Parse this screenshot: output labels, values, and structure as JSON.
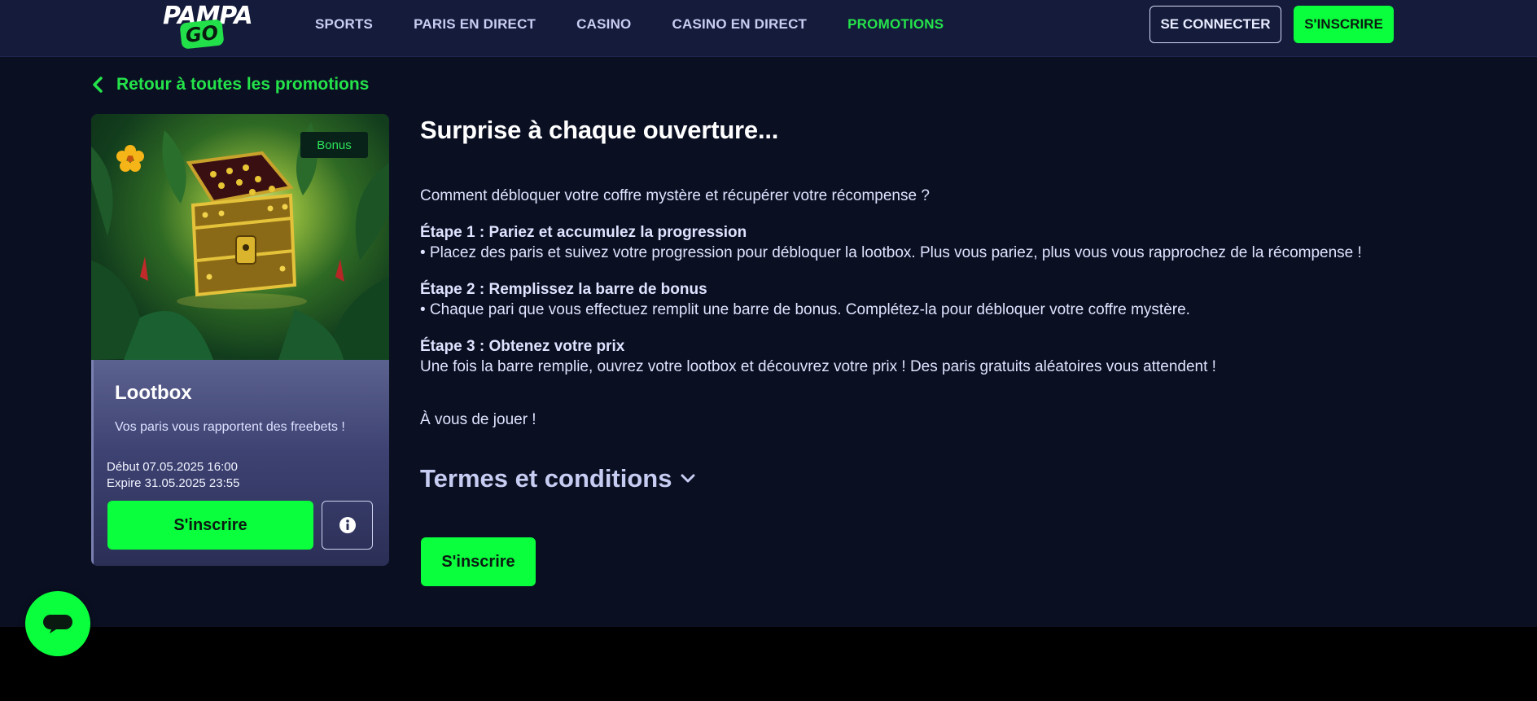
{
  "header": {
    "logo_word": "PAMPA",
    "logo_go": "GO",
    "nav": [
      "SPORTS",
      "PARIS EN DIRECT",
      "CASINO",
      "CASINO EN DIRECT",
      "PROMOTIONS"
    ],
    "active_nav": "PROMOTIONS",
    "login_label": "SE CONNECTER",
    "register_label": "S'INSCRIRE"
  },
  "back_link": "Retour à toutes les promotions",
  "card": {
    "badge": "Bonus",
    "title": "Lootbox",
    "subtitle": "Vos paris vous rapportent des freebets !",
    "start": "Début 07.05.2025 16:00",
    "end": "Expire 31.05.2025 23:55",
    "cta": "S'inscrire",
    "info_icon": "info-icon"
  },
  "content": {
    "title": "Surprise à chaque ouverture...",
    "intro": "Comment débloquer votre coffre mystère et récupérer votre récompense ?",
    "steps": [
      {
        "heading": "Étape 1 : Pariez et accumulez la progression",
        "text": "• Placez des paris et suivez votre progression pour débloquer la lootbox. Plus vous pariez, plus vous vous rapprochez de la récompense !"
      },
      {
        "heading": "Étape 2 : Remplissez la barre de bonus",
        "text": "• Chaque pari que vous effectuez remplit une barre de bonus. Complétez-la pour débloquer votre coffre mystère."
      },
      {
        "heading": "Étape 3 : Obtenez votre prix",
        "text": "Une fois la barre remplie, ouvrez votre lootbox et découvrez votre prix ! Des paris gratuits aléatoires vous attendent !"
      }
    ],
    "outro": "À vous de jouer !",
    "terms_label": "Termes et conditions",
    "cta": "S'inscrire"
  },
  "colors": {
    "brand_green": "#0aff3c",
    "header_bg": "#141b3b",
    "page_bg": "#0a0f22"
  },
  "chat_icon": "chat-icon"
}
